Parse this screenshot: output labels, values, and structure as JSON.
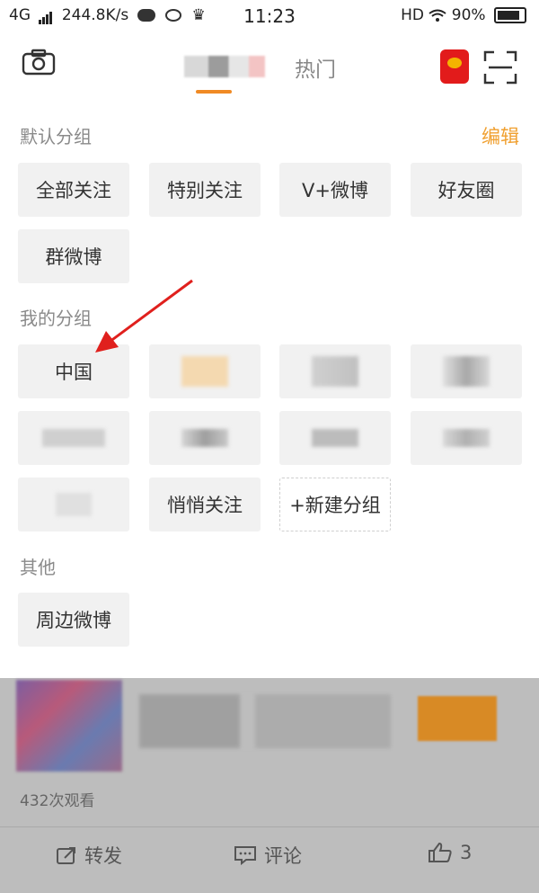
{
  "status_bar": {
    "network": "4G",
    "speed": "244.8K/s",
    "time": "11:23",
    "hd": "HD",
    "battery": "90%"
  },
  "nav": {
    "tab_hot": "热门"
  },
  "groups": {
    "default_title": "默认分组",
    "edit_label": "编辑",
    "default_items": [
      "全部关注",
      "特别关注",
      "V+微博",
      "好友圈",
      "群微博"
    ],
    "my_title": "我的分组",
    "my_items": [
      "中国",
      "悄悄关注",
      "+新建分组"
    ],
    "other_title": "其他",
    "other_items": [
      "周边微博"
    ]
  },
  "feed": {
    "views": "432次观看",
    "repost_label": "转发",
    "comment_label": "评论",
    "like_count": "3"
  },
  "colors": {
    "accent": "#f0a030",
    "tab_indicator": "#f08a24",
    "arrow": "#e0201d"
  }
}
